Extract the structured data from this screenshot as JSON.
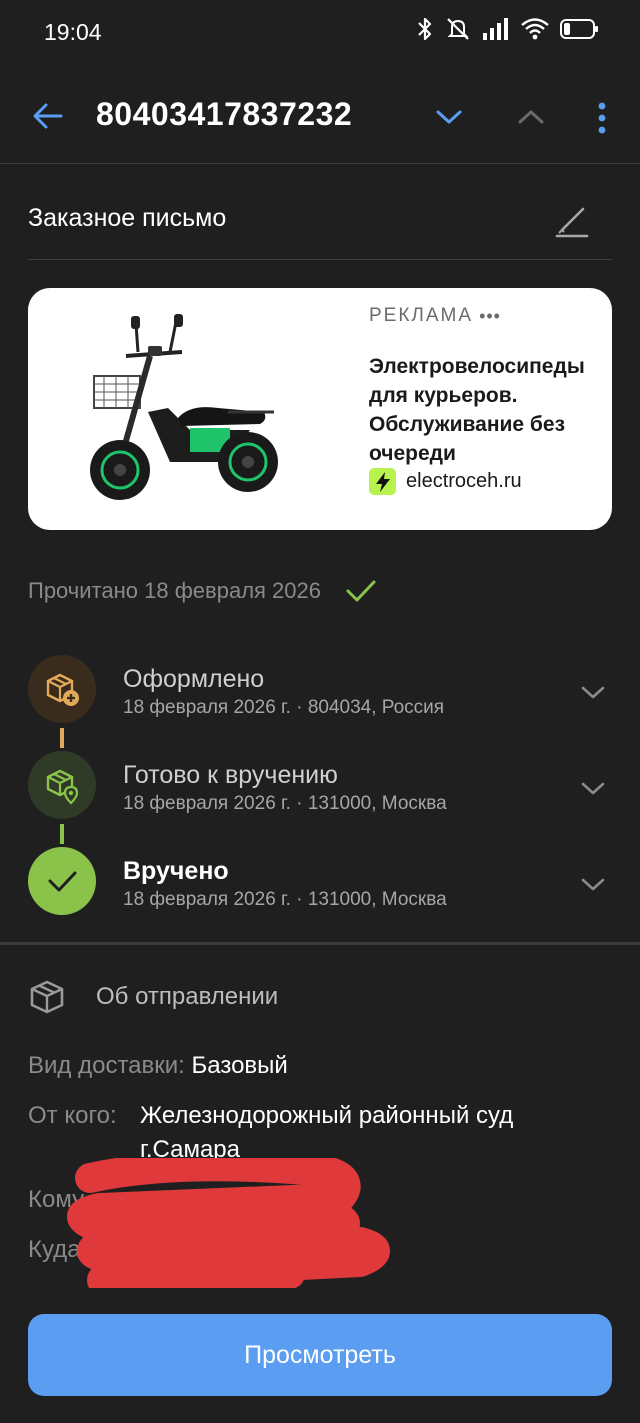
{
  "status_bar": {
    "time": "19:04",
    "icons": [
      "bluetooth-icon",
      "mute-icon",
      "signal-icon",
      "wifi-icon",
      "battery-icon"
    ]
  },
  "topbar": {
    "track_number": "80403417837232",
    "icons": [
      "back-arrow-icon",
      "chevron-down-icon",
      "chevron-up-icon",
      "more-vertical-icon"
    ]
  },
  "letter": {
    "type": "Заказное письмо"
  },
  "ad": {
    "label": "РЕКЛАМА",
    "title": "Электровелосипеды для курьеров. Обслуживание без очереди",
    "domain": "electroceh.ru"
  },
  "read_status": {
    "text": "Прочитано 18 февраля 2026"
  },
  "timeline": [
    {
      "title": "Оформлено",
      "subtitle": "18 февраля 2026 г. · 804034, Россия",
      "icon": "package-plus-icon"
    },
    {
      "title": "Готово к вручению",
      "subtitle": "18 февраля 2026 г. · 131000, Москва",
      "icon": "package-location-icon"
    },
    {
      "title": "Вручено",
      "subtitle": "18 февраля 2026 г. · 131000, Москва",
      "icon": "check-icon"
    }
  ],
  "about": {
    "title": "Об отправлении",
    "delivery_label": "Вид доставки:",
    "delivery_value": "Базовый",
    "from_label": "От кого:",
    "from_value": "Железнодорожный районный суд г.Самара",
    "to_label_partial": "Кому",
    "where_label_partial": "Куда"
  },
  "colors": {
    "background": "#1f1f1f",
    "accent_blue": "#5b9df0",
    "check_green": "#8bc34a",
    "timeline_orange": "#e3a95a",
    "redaction_red": "#e0393b"
  },
  "primary_button": {
    "label": "Просмотреть"
  }
}
